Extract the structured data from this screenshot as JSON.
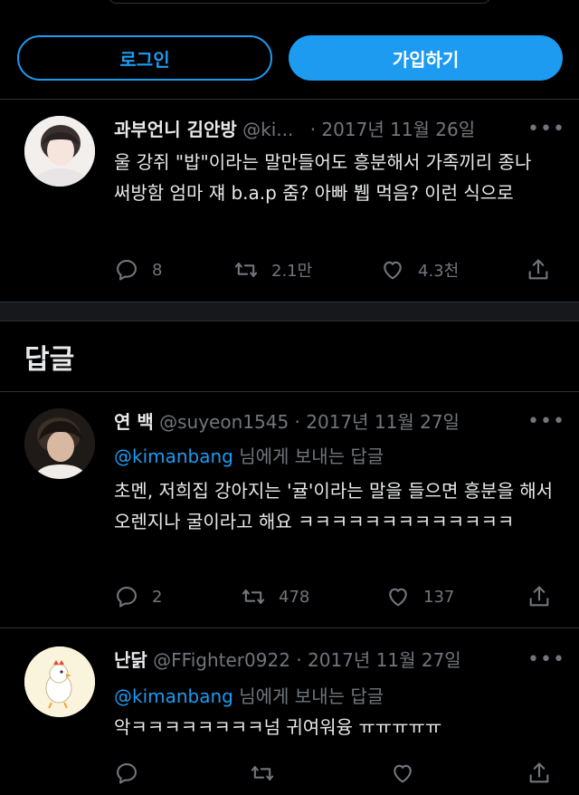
{
  "auth": {
    "login_label": "로그인",
    "signup_label": "가입하기"
  },
  "main_tweet": {
    "name": "과부언니 김안방",
    "handle": "@ki...",
    "date": "· 2017년 11월 26일",
    "text": "울 강쥐 \"밥\"이라는 말만들어도 흥분해서 가족끼리 종나 써방함 엄마 쟤  b.a.p 줌? 아빠 뷉 먹음? 이런 식으로",
    "replies": "8",
    "retweets": "2.1만",
    "likes": "4.3천"
  },
  "replies_section": {
    "title": "답글"
  },
  "replies": [
    {
      "name": "연 백",
      "handle": "@suyeon1545",
      "date": "· 2017년 11월 27일",
      "reply_to_handle": "@kimanbang",
      "reply_to_suffix": " 님에게 보내는 답글",
      "text": "초멘, 저희집 강아지는 '귤'이라는 말을 들으면 흥분을 해서 오렌지나 굴이라고 해요 ㅋㅋㅋㅋㅋㅋㅋㅋㅋㅋㅋㅋㅋ",
      "replies": "2",
      "retweets": "478",
      "likes": "137"
    },
    {
      "name": "난닭",
      "handle": "@FFighter0922",
      "date": "· 2017년 11월 27일",
      "reply_to_handle": "@kimanbang",
      "reply_to_suffix": " 님에게 보내는 답글",
      "text": "악ㅋㅋㅋㅋㅋㅋㅋㅋ넘 귀여워융 ㅠㅠㅠㅠㅠ",
      "replies": "",
      "retweets": "",
      "likes": ""
    }
  ],
  "icons": {
    "reply": "reply-icon",
    "retweet": "retweet-icon",
    "like": "heart-icon",
    "share": "share-icon",
    "more": "more-icon"
  },
  "colors": {
    "accent": "#1d9bf0",
    "background": "#000000",
    "muted": "#71767b",
    "text": "#e7e9ea"
  }
}
